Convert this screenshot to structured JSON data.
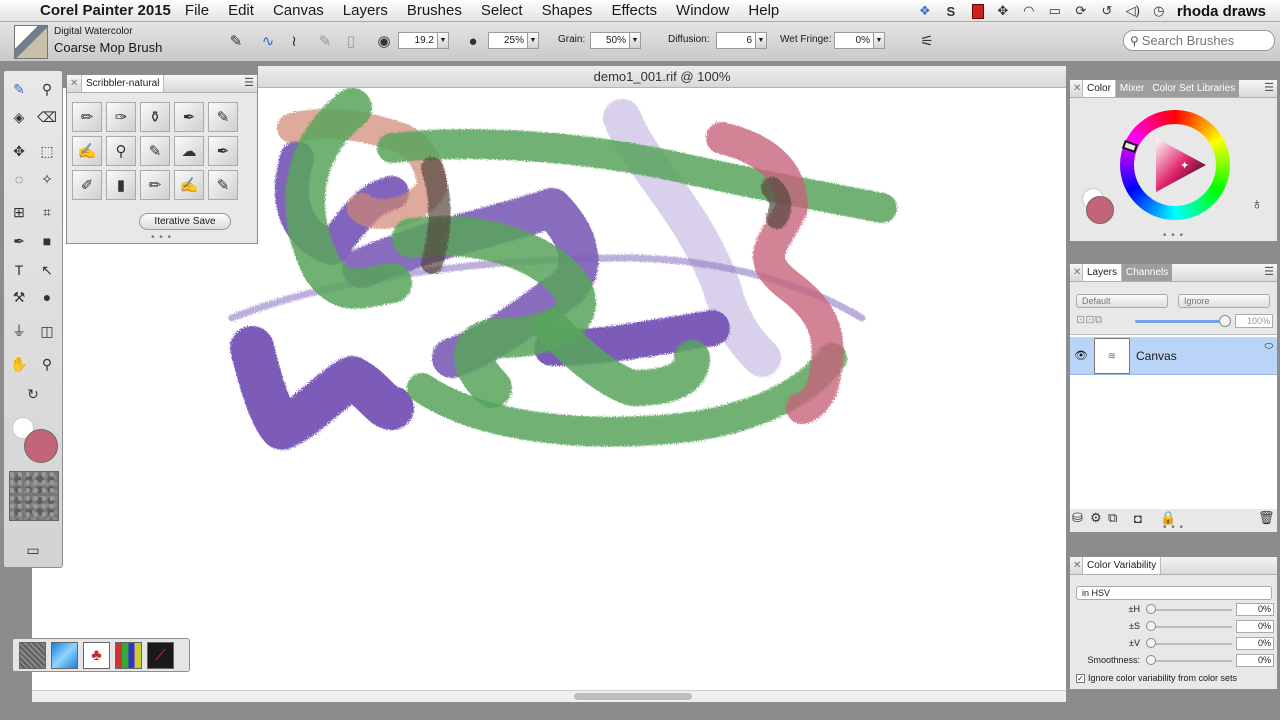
{
  "menubar": {
    "apple_glyph": "",
    "app_name": "Corel Painter 2015",
    "menus": [
      "File",
      "Edit",
      "Canvas",
      "Layers",
      "Brushes",
      "Select",
      "Shapes",
      "Effects",
      "Window",
      "Help"
    ],
    "status_icons": [
      "dropbox-icon",
      "skype-icon",
      "film-icon",
      "move-icon",
      "wifi-icon",
      "display-icon",
      "sync-icon",
      "timemachine-icon",
      "volume-icon",
      "clock-icon"
    ],
    "user": "rhoda draws"
  },
  "propbar": {
    "brush_category": "Digital Watercolor",
    "brush_variant": "Coarse Mop Brush",
    "size_value": "19.2",
    "opacity_value": "25%",
    "grain_label": "Grain:",
    "grain_value": "50%",
    "diffusion_label": "Diffusion:",
    "diffusion_value": "6",
    "wet_fringe_label": "Wet Fringe:",
    "wet_fringe_value": "0%",
    "search_placeholder": "Search Brushes"
  },
  "document": {
    "title": "demo1_001.rif @ 100%"
  },
  "toolbox": {
    "main_color": "#c46479",
    "additional_color": "#ffffff"
  },
  "scribbler": {
    "title": "Scribbler-natural",
    "iterative_save": "Iterative Save",
    "dots": "• • •"
  },
  "color_panel": {
    "tabs": [
      "Color",
      "Mixer",
      "Color Set Libraries"
    ],
    "main_color": "#c46479",
    "dots": "• • •"
  },
  "layers_panel": {
    "tabs": [
      "Layers",
      "Channels"
    ],
    "composite_method": "Default",
    "composite_depth": "Ignore",
    "opacity": "100%",
    "layer_name": "Canvas",
    "dots": "• • •"
  },
  "color_variability": {
    "title": "Color Variability",
    "mode": "in HSV",
    "rows": [
      {
        "label": "±H",
        "value": "0%"
      },
      {
        "label": "±S",
        "value": "0%"
      },
      {
        "label": "±V",
        "value": "0%"
      },
      {
        "label": "Smoothness:",
        "value": "0%"
      }
    ],
    "checkbox_label": "Ignore color variability from color sets",
    "checkbox_checked": true
  },
  "canvas_strokes": {
    "colors": {
      "purple": "#7c5cb8",
      "green": "#58a45c",
      "pink": "#c8647c",
      "lavender": "#c9bde3",
      "salmon": "#cf8672"
    }
  }
}
